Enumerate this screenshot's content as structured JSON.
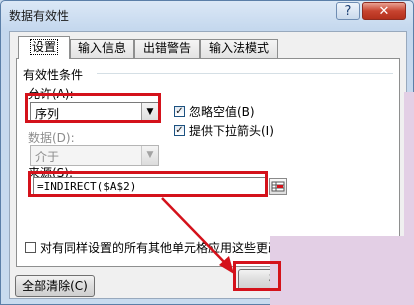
{
  "window": {
    "title": "数据有效性",
    "help_label": "?",
    "close_label": "✕"
  },
  "tabs": [
    {
      "label": "设置",
      "active": true
    },
    {
      "label": "输入信息",
      "active": false
    },
    {
      "label": "出错警告",
      "active": false
    },
    {
      "label": "输入法模式",
      "active": false
    }
  ],
  "settings": {
    "group_title": "有效性条件",
    "allow_label": "允许(A):",
    "allow_value": "序列",
    "ignore_blank_label": "忽略空值(B)",
    "ignore_blank_checked": true,
    "dropdown_label": "提供下拉箭头(I)",
    "dropdown_checked": true,
    "data_label": "数据(D):",
    "data_value": "介于",
    "source_label": "来源(S):",
    "source_value": "=INDIRECT($A$2)",
    "apply_all_label": "对有同样设置的所有其他单元格应用这些更改",
    "apply_all_checked": false
  },
  "buttons": {
    "clear_all": "全部清除(C)",
    "ok": "确"
  },
  "colors": {
    "highlight": "#d4121b",
    "arrow": "#d4121b",
    "overlay": "#e3cfe5"
  }
}
